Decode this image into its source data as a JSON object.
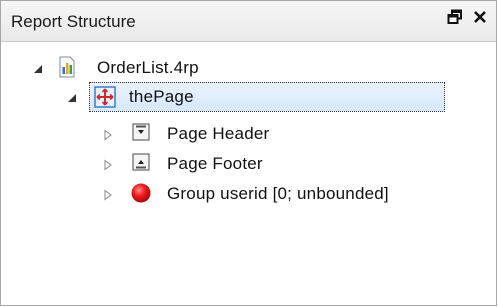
{
  "panel": {
    "title": "Report Structure",
    "float_icon": "restore-window-icon",
    "close_icon": "close-icon"
  },
  "tree": {
    "root": {
      "label": "OrderList.4rp",
      "icon": "report-file-icon",
      "expanded": true
    },
    "page": {
      "label": "thePage",
      "icon": "page-layout-icon",
      "expanded": true,
      "selected": true
    },
    "children": [
      {
        "label": "Page Header",
        "icon": "section-box-icon",
        "expanded": false
      },
      {
        "label": "Page Footer",
        "icon": "section-box-icon",
        "expanded": false
      },
      {
        "label": "Group userid [0; unbounded]",
        "icon": "red-circle-icon",
        "expanded": false
      }
    ]
  },
  "colors": {
    "selection": "#d6e8fb",
    "group_icon": "#e01010",
    "page_icon": "#2f73c8"
  }
}
